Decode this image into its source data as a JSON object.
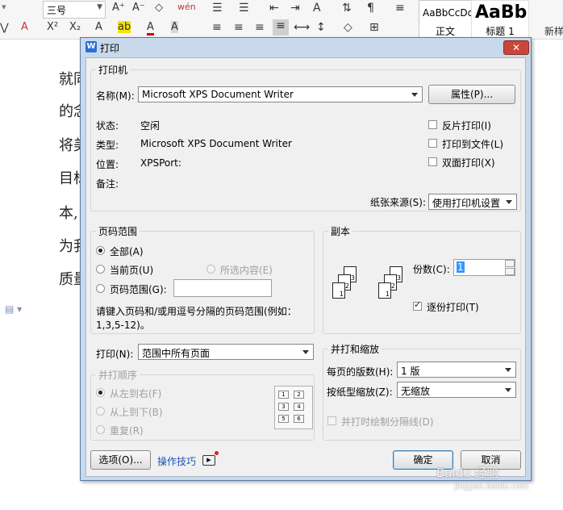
{
  "editor": {
    "ribbon": {
      "font_size_value": "三号",
      "increase_font_glyph": "A⁺",
      "decrease_font_glyph": "A⁻",
      "clear_format_glyph": "◇",
      "phonetic_glyph": "wén",
      "style_normal_preview": "AaBbCcDd",
      "style_normal_name": "正文",
      "style_heading_preview": "AaBb",
      "style_heading_name": "标题 1",
      "new_style_label": "新样",
      "superscript_glyph": "X²",
      "font_color_glyph": "A",
      "strike_glyph": "A"
    },
    "doc_lines": [
      "就同",
      "的念",
      "将美",
      "目标",
      "本,",
      "为我",
      "质量"
    ]
  },
  "dialog": {
    "title": "打印",
    "close_glyph": "✕",
    "printer_group": {
      "title": "打印机",
      "name_label": "名称(M):",
      "name_value": "Microsoft XPS Document Writer",
      "properties_button": "属性(P)...",
      "status_label": "状态:",
      "status_value": "空闲",
      "type_label": "类型:",
      "type_value": "Microsoft XPS Document Writer",
      "where_label": "位置:",
      "where_value": "XPSPort:",
      "comment_label": "备注:",
      "reverse_print": {
        "label": "反片打印(I)",
        "checked": false
      },
      "print_to_file": {
        "label": "打印到文件(L)",
        "checked": false
      },
      "duplex": {
        "label": "双面打印(X)",
        "checked": false
      },
      "paper_source_label": "纸张来源(S):",
      "paper_source_value": "使用打印机设置"
    },
    "page_range": {
      "title": "页码范围",
      "all": "全部(A)",
      "current": "当前页(U)",
      "selection": "所选内容(E)",
      "pages": "页码范围(G):",
      "hint": "请键入页码和/或用逗号分隔的页码范围(例如：",
      "hint2": "1,3,5-12)。"
    },
    "copies": {
      "title": "副本",
      "count_label": "份数(C):",
      "count_value": "1",
      "collate_label": "逐份打印(T)",
      "collate_checked": true,
      "page_numbers": [
        "1",
        "2",
        "3"
      ]
    },
    "print_what": {
      "label": "打印(N):",
      "value": "范围中所有页面"
    },
    "order": {
      "title": "并打顺序",
      "left_to_right": "从左到右(F)",
      "top_to_bottom": "从上到下(B)",
      "repeat": "重复(R)",
      "grid_numbers": [
        "1",
        "2",
        "3",
        "4",
        "5",
        "6"
      ]
    },
    "zoom": {
      "title": "并打和缩放",
      "pages_per_sheet_label": "每页的版数(H):",
      "pages_per_sheet_value": "1 版",
      "scale_label": "按纸型缩放(Z):",
      "scale_value": "无缩放",
      "draw_lines_label": "并打时绘制分隔线(D)"
    },
    "footer": {
      "options_button": "选项(O)...",
      "tips_link": "操作技巧",
      "ok_button": "确定",
      "cancel_button": "取消"
    }
  },
  "watermark": {
    "brand": "Baidu 经验",
    "url": "jingyan.baidu.com"
  }
}
